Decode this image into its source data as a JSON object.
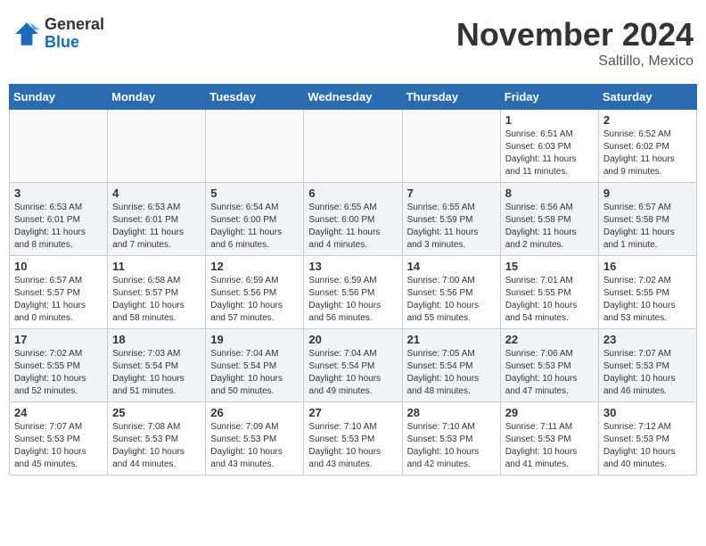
{
  "header": {
    "logo_general": "General",
    "logo_blue": "Blue",
    "month_title": "November 2024",
    "subtitle": "Saltillo, Mexico"
  },
  "days_of_week": [
    "Sunday",
    "Monday",
    "Tuesday",
    "Wednesday",
    "Thursday",
    "Friday",
    "Saturday"
  ],
  "weeks": [
    [
      {
        "day": "",
        "info": ""
      },
      {
        "day": "",
        "info": ""
      },
      {
        "day": "",
        "info": ""
      },
      {
        "day": "",
        "info": ""
      },
      {
        "day": "",
        "info": ""
      },
      {
        "day": "1",
        "info": "Sunrise: 6:51 AM\nSunset: 6:03 PM\nDaylight: 11 hours\nand 11 minutes."
      },
      {
        "day": "2",
        "info": "Sunrise: 6:52 AM\nSunset: 6:02 PM\nDaylight: 11 hours\nand 9 minutes."
      }
    ],
    [
      {
        "day": "3",
        "info": "Sunrise: 6:53 AM\nSunset: 6:01 PM\nDaylight: 11 hours\nand 8 minutes."
      },
      {
        "day": "4",
        "info": "Sunrise: 6:53 AM\nSunset: 6:01 PM\nDaylight: 11 hours\nand 7 minutes."
      },
      {
        "day": "5",
        "info": "Sunrise: 6:54 AM\nSunset: 6:00 PM\nDaylight: 11 hours\nand 6 minutes."
      },
      {
        "day": "6",
        "info": "Sunrise: 6:55 AM\nSunset: 6:00 PM\nDaylight: 11 hours\nand 4 minutes."
      },
      {
        "day": "7",
        "info": "Sunrise: 6:55 AM\nSunset: 5:59 PM\nDaylight: 11 hours\nand 3 minutes."
      },
      {
        "day": "8",
        "info": "Sunrise: 6:56 AM\nSunset: 5:58 PM\nDaylight: 11 hours\nand 2 minutes."
      },
      {
        "day": "9",
        "info": "Sunrise: 6:57 AM\nSunset: 5:58 PM\nDaylight: 11 hours\nand 1 minute."
      }
    ],
    [
      {
        "day": "10",
        "info": "Sunrise: 6:57 AM\nSunset: 5:57 PM\nDaylight: 11 hours\nand 0 minutes."
      },
      {
        "day": "11",
        "info": "Sunrise: 6:58 AM\nSunset: 5:57 PM\nDaylight: 10 hours\nand 58 minutes."
      },
      {
        "day": "12",
        "info": "Sunrise: 6:59 AM\nSunset: 5:56 PM\nDaylight: 10 hours\nand 57 minutes."
      },
      {
        "day": "13",
        "info": "Sunrise: 6:59 AM\nSunset: 5:56 PM\nDaylight: 10 hours\nand 56 minutes."
      },
      {
        "day": "14",
        "info": "Sunrise: 7:00 AM\nSunset: 5:56 PM\nDaylight: 10 hours\nand 55 minutes."
      },
      {
        "day": "15",
        "info": "Sunrise: 7:01 AM\nSunset: 5:55 PM\nDaylight: 10 hours\nand 54 minutes."
      },
      {
        "day": "16",
        "info": "Sunrise: 7:02 AM\nSunset: 5:55 PM\nDaylight: 10 hours\nand 53 minutes."
      }
    ],
    [
      {
        "day": "17",
        "info": "Sunrise: 7:02 AM\nSunset: 5:55 PM\nDaylight: 10 hours\nand 52 minutes."
      },
      {
        "day": "18",
        "info": "Sunrise: 7:03 AM\nSunset: 5:54 PM\nDaylight: 10 hours\nand 51 minutes."
      },
      {
        "day": "19",
        "info": "Sunrise: 7:04 AM\nSunset: 5:54 PM\nDaylight: 10 hours\nand 50 minutes."
      },
      {
        "day": "20",
        "info": "Sunrise: 7:04 AM\nSunset: 5:54 PM\nDaylight: 10 hours\nand 49 minutes."
      },
      {
        "day": "21",
        "info": "Sunrise: 7:05 AM\nSunset: 5:54 PM\nDaylight: 10 hours\nand 48 minutes."
      },
      {
        "day": "22",
        "info": "Sunrise: 7:06 AM\nSunset: 5:53 PM\nDaylight: 10 hours\nand 47 minutes."
      },
      {
        "day": "23",
        "info": "Sunrise: 7:07 AM\nSunset: 5:53 PM\nDaylight: 10 hours\nand 46 minutes."
      }
    ],
    [
      {
        "day": "24",
        "info": "Sunrise: 7:07 AM\nSunset: 5:53 PM\nDaylight: 10 hours\nand 45 minutes."
      },
      {
        "day": "25",
        "info": "Sunrise: 7:08 AM\nSunset: 5:53 PM\nDaylight: 10 hours\nand 44 minutes."
      },
      {
        "day": "26",
        "info": "Sunrise: 7:09 AM\nSunset: 5:53 PM\nDaylight: 10 hours\nand 43 minutes."
      },
      {
        "day": "27",
        "info": "Sunrise: 7:10 AM\nSunset: 5:53 PM\nDaylight: 10 hours\nand 43 minutes."
      },
      {
        "day": "28",
        "info": "Sunrise: 7:10 AM\nSunset: 5:53 PM\nDaylight: 10 hours\nand 42 minutes."
      },
      {
        "day": "29",
        "info": "Sunrise: 7:11 AM\nSunset: 5:53 PM\nDaylight: 10 hours\nand 41 minutes."
      },
      {
        "day": "30",
        "info": "Sunrise: 7:12 AM\nSunset: 5:53 PM\nDaylight: 10 hours\nand 40 minutes."
      }
    ]
  ]
}
